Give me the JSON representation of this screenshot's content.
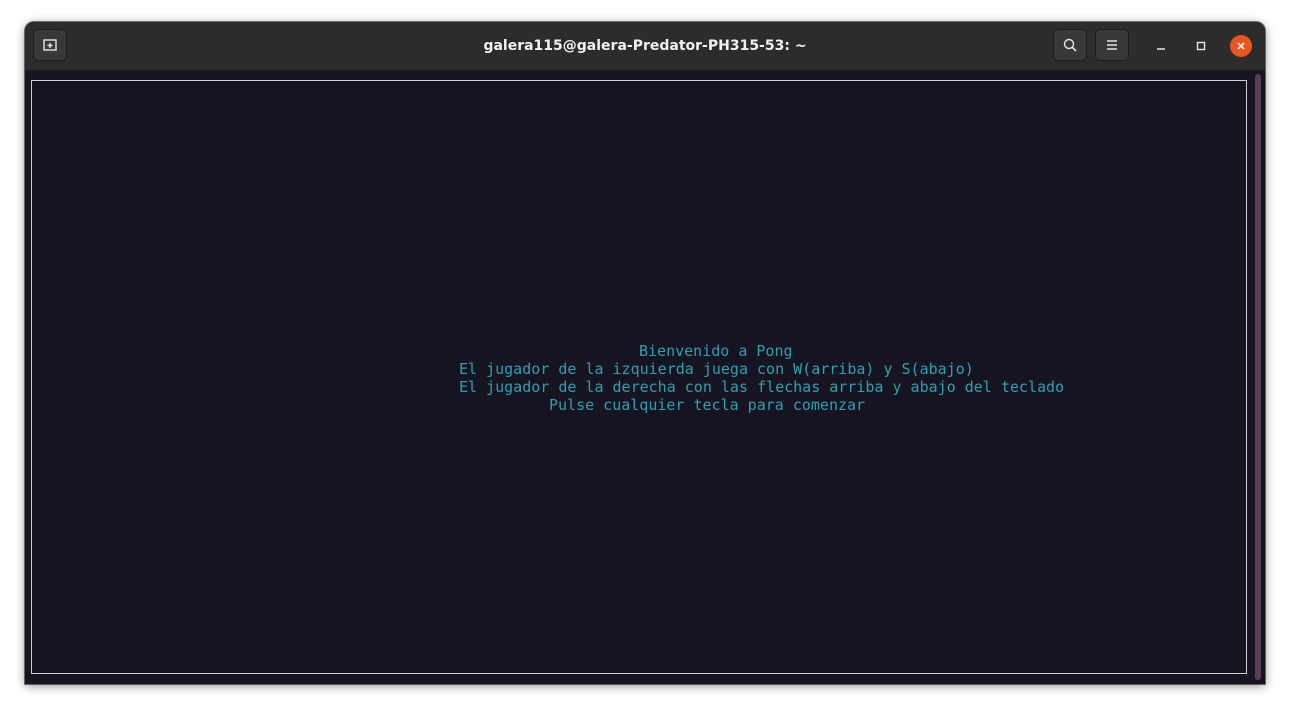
{
  "window": {
    "title": "galera115@galera-Predator-PH315-53: ~"
  },
  "header_buttons": {
    "new_tab_icon": "new-tab-icon",
    "search_icon": "search-icon",
    "menu_icon": "hamburger-menu-icon",
    "minimize_icon": "minimize-icon",
    "maximize_icon": "maximize-icon",
    "close_icon": "close-icon"
  },
  "terminal": {
    "lines": [
      "Bienvenido a Pong",
      "El jugador de la izquierda juega con W(arriba) y S(abajo)",
      "El jugador de la derecha con las flechas arriba y abajo del teclado",
      "Pulse cualquier tecla para comenzar"
    ]
  },
  "colors": {
    "terminal_background": "#171421",
    "terminal_text": "#2aa1b3",
    "titlebar": "#2c2c2c",
    "close_button": "#e9541f"
  }
}
